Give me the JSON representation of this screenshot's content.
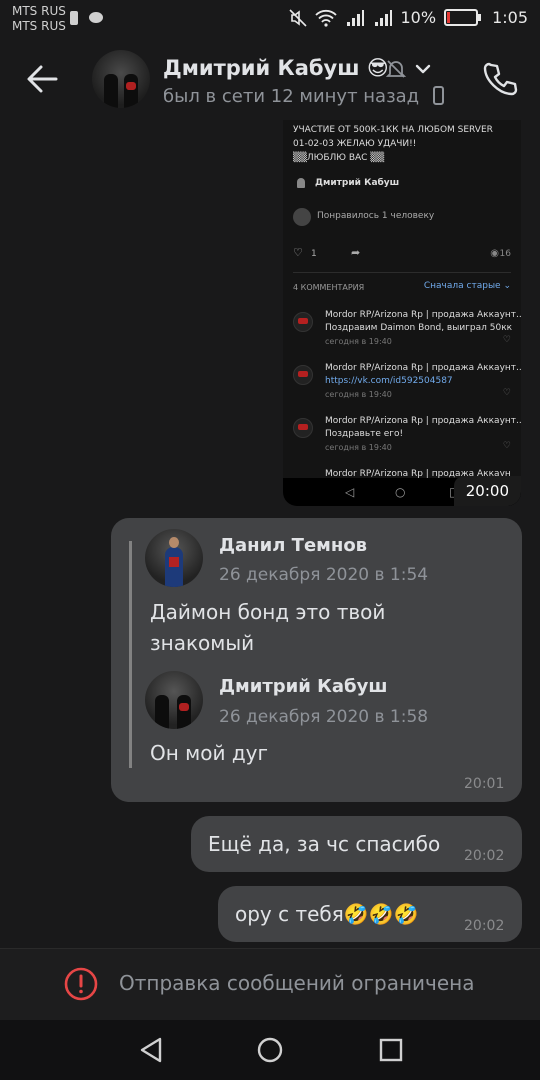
{
  "status_bar": {
    "carrier1": "MTS RUS",
    "carrier2": "MTS RUS",
    "battery": "10%",
    "time": "1:05"
  },
  "header": {
    "name": "Дмитрий Кабуш 😎",
    "status": "был в сети 12 минут назад"
  },
  "shared_screenshot": {
    "post_text_line1": "УЧАСТИЕ ОТ 500К-1КК НА ЛЮБОМ SERVER",
    "post_text_line2": "01-02-03 ЖЕЛАЮ УДАЧИ!!",
    "post_text_line3": "▒▒ЛЮБЛЮ ВАС ▒▒",
    "author": "Дмитрий Кабуш",
    "liked": "Понравилось 1 человеку",
    "likes": "1",
    "views": "16",
    "comments_header": "4 КОММЕНТАРИЯ",
    "sort": "Сначала старые",
    "comments": [
      {
        "author": "Mordor RP/Arizona Rp | продажа Аккаунт...",
        "text": "Поздравим Daimon Bond, выиграл 50кк",
        "time": "сегодня в 19:40"
      },
      {
        "author": "Mordor RP/Arizona Rp | продажа Аккаунт...",
        "text": "https://vk.com/id592504587",
        "time": "сегодня в 19:40"
      },
      {
        "author": "Mordor RP/Arizona Rp | продажа Аккаунт...",
        "text": "Поздравьте его!",
        "time": "сегодня в 19:40"
      },
      {
        "author": "Mordor RP/Arizona Rp | продажа Аккаунт...",
        "text": "",
        "time": ""
      }
    ],
    "time": "20:00"
  },
  "messages": {
    "quoted": {
      "outer_name": "Данил Темнов",
      "outer_date": "26 декабря 2020 в 1:54",
      "outer_text": "Даймон бонд это твой знакомый",
      "inner_name": "Дмитрий Кабуш",
      "inner_date": "26 декабря 2020 в 1:58",
      "inner_text": "Он мой дуг",
      "time": "20:01"
    },
    "msg2": {
      "text": "Ещё да, за чс спасибо",
      "time": "20:02"
    },
    "msg3": {
      "text": "ору с тебя🤣🤣🤣",
      "time": "20:02"
    }
  },
  "bottom": {
    "restriction": "Отправка сообщений ограничена"
  },
  "colors": {
    "accent": "#71aaeb",
    "error": "#e64646",
    "bubble": "#424345"
  }
}
